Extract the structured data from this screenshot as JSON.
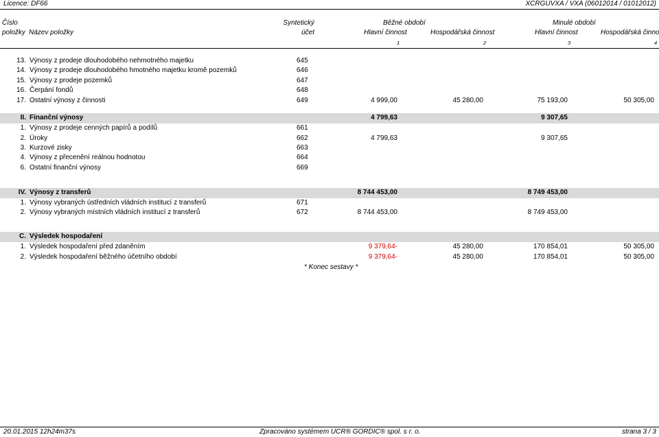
{
  "top": {
    "licence": "Licence: DF66",
    "right": "XCRGUVXA / VXA (06012014 / 01012012)"
  },
  "header": {
    "cislo": "Číslo",
    "polozky": "položky",
    "nazev": "Název položky",
    "synteticky": "Syntetický",
    "ucet": "účet",
    "bezne": "Běžné období",
    "minule": "Minulé období",
    "hlavni1": "Hlavní činnost",
    "hosp1": "Hospodářská činnost",
    "hlavni2": "Hlavní činnost",
    "hosp2": "Hospodářská činnost",
    "n1": "1",
    "n2": "2",
    "n3": "3",
    "n4": "4"
  },
  "rows": [
    {
      "num": "13.",
      "name": "Výnosy z prodeje dlouhodobého nehmotného majetku",
      "acct": "645",
      "c1": "",
      "c2": "",
      "c3": "",
      "c4": ""
    },
    {
      "num": "14.",
      "name": "Výnosy z prodeje dlouhodobého hmotného majetku kromě pozemků",
      "acct": "646",
      "c1": "",
      "c2": "",
      "c3": "",
      "c4": ""
    },
    {
      "num": "15.",
      "name": "Výnosy z prodeje pozemků",
      "acct": "647",
      "c1": "",
      "c2": "",
      "c3": "",
      "c4": ""
    },
    {
      "num": "16.",
      "name": "Čerpání fondů",
      "acct": "648",
      "c1": "",
      "c2": "",
      "c3": "",
      "c4": ""
    },
    {
      "num": "17.",
      "name": "Ostatní výnosy z činnosti",
      "acct": "649",
      "c1": "4 999,00",
      "c2": "45 280,00",
      "c3": "75 193,00",
      "c4": "50 305,00"
    },
    {
      "section": true,
      "num": "II.",
      "name": "Finanční výnosy",
      "acct": "",
      "c1": "4 799,63",
      "c2": "",
      "c3": "9 307,65",
      "c4": ""
    },
    {
      "num": "1.",
      "name": "Výnosy z prodeje cenných papírů a podílů",
      "acct": "661",
      "c1": "",
      "c2": "",
      "c3": "",
      "c4": ""
    },
    {
      "num": "2.",
      "name": "Úroky",
      "acct": "662",
      "c1": "4 799,63",
      "c2": "",
      "c3": "9 307,65",
      "c4": ""
    },
    {
      "num": "3.",
      "name": "Kurzové zisky",
      "acct": "663",
      "c1": "",
      "c2": "",
      "c3": "",
      "c4": ""
    },
    {
      "num": "4.",
      "name": "Výnosy z přecenění reálnou hodnotou",
      "acct": "664",
      "c1": "",
      "c2": "",
      "c3": "",
      "c4": ""
    },
    {
      "num": "6.",
      "name": "Ostatní finanční výnosy",
      "acct": "669",
      "c1": "",
      "c2": "",
      "c3": "",
      "c4": ""
    },
    {
      "section": true,
      "num": "IV.",
      "name": "Výnosy z transferů",
      "acct": "",
      "c1": "8 744 453,00",
      "c2": "",
      "c3": "8 749 453,00",
      "c4": ""
    },
    {
      "num": "1.",
      "name": "Výnosy vybraných ústředních vládních institucí z transferů",
      "acct": "671",
      "c1": "",
      "c2": "",
      "c3": "",
      "c4": ""
    },
    {
      "num": "2.",
      "name": "Výnosy vybraných místních vládních institucí z transferů",
      "acct": "672",
      "c1": "8 744 453,00",
      "c2": "",
      "c3": "8 749 453,00",
      "c4": ""
    },
    {
      "section": true,
      "num": "C.",
      "name": "Výsledek hospodaření",
      "acct": "",
      "c1": "",
      "c2": "",
      "c3": "",
      "c4": ""
    },
    {
      "num": "1.",
      "name": "Výsledek hospodaření před zdaněním",
      "acct": "",
      "c1": "9 379,64-",
      "c1red": true,
      "c2": "45 280,00",
      "c3": "170 854,01",
      "c4": "50 305,00"
    },
    {
      "num": "2.",
      "name": "Výsledek hospodaření běžného účetního období",
      "acct": "",
      "c1": "9 379,64-",
      "c1red": true,
      "c2": "45 280,00",
      "c3": "170 854,01",
      "c4": "50 305,00"
    }
  ],
  "end_note": "* Konec sestavy *",
  "footer": {
    "date": "20.01.2015 12h24m37s",
    "system": "Zpracováno systémem UCR® GORDIC® spol. s  r. o.",
    "page": "strana 3 / 3"
  },
  "colors": {
    "band": "#d9d9d9",
    "negative": "#d40000"
  }
}
